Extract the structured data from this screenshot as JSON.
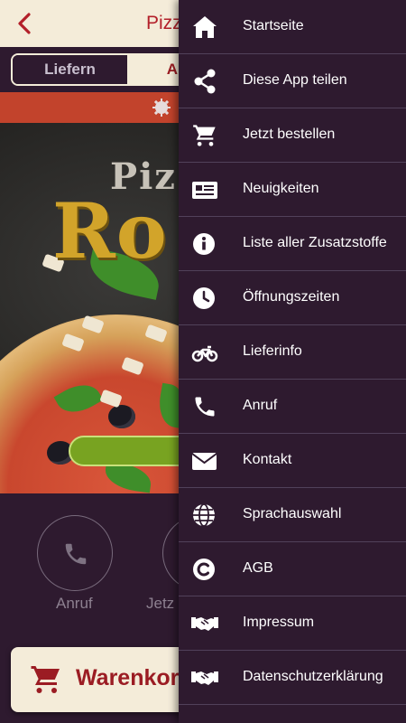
{
  "app": {
    "title": "Pizz",
    "back_icon": "chevron-left-icon",
    "title_color": "#b3202a"
  },
  "order_mode": {
    "options": [
      "Liefern",
      "Abho"
    ],
    "selected": "Abho"
  },
  "banner": {
    "icon": "gear-badge-icon",
    "color": "#c2432c"
  },
  "hero": {
    "logo_top": "Piz",
    "logo_main": "Ro"
  },
  "quick_actions": [
    {
      "label": "Anruf",
      "icon": "phone-icon"
    },
    {
      "label": "Jetz",
      "icon": "cart-icon"
    }
  ],
  "cart_button": {
    "label": "Warenkorb",
    "icon": "cart-icon"
  },
  "drawer": {
    "items": [
      {
        "label": "Startseite",
        "icon": "home-icon"
      },
      {
        "label": "Diese App teilen",
        "icon": "share-icon"
      },
      {
        "label": "Jetzt bestellen",
        "icon": "cart-icon"
      },
      {
        "label": "Neuigkeiten",
        "icon": "newspaper-icon"
      },
      {
        "label": "Liste aller Zusatzstoffe",
        "icon": "info-icon"
      },
      {
        "label": "Öffnungszeiten",
        "icon": "clock-icon"
      },
      {
        "label": "Lieferinfo",
        "icon": "motorcycle-icon"
      },
      {
        "label": "Anruf",
        "icon": "phone-icon"
      },
      {
        "label": "Kontakt",
        "icon": "envelope-icon"
      },
      {
        "label": "Sprachauswahl",
        "icon": "globe-icon"
      },
      {
        "label": "AGB",
        "icon": "copyright-icon"
      },
      {
        "label": "Impressum",
        "icon": "handshake-icon"
      },
      {
        "label": "Datenschutzerklärung",
        "icon": "handshake-icon"
      }
    ]
  },
  "colors": {
    "background": "#2e1a2f",
    "cream": "#f4ecd9",
    "accent_red": "#9b1c23",
    "divider": "#51415a"
  }
}
